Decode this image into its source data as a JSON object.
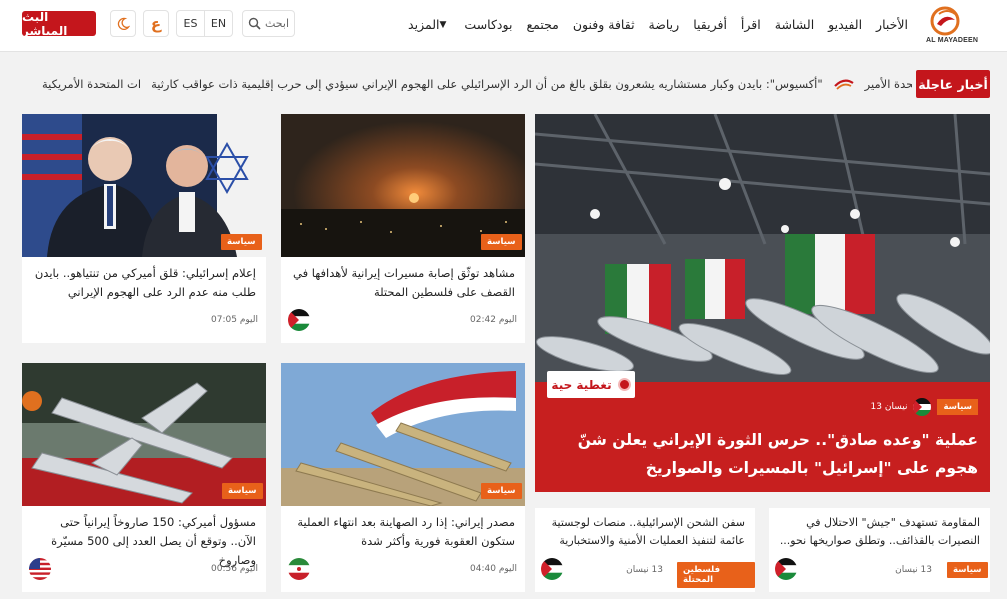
{
  "header": {
    "live_label": "البث المباشر",
    "arabic_label": "ع",
    "lang_en": "EN",
    "lang_es": "ES",
    "search_label": "ابحث",
    "logo_caption": "AL MAYADEEN",
    "nav": [
      "الأخبار",
      "الفيديو",
      "الشاشة",
      "اقرأ",
      "أفريقيا",
      "رياضة",
      "ثقافة وفنون",
      "مجتمع",
      "بودكاست",
      "المزيد"
    ]
  },
  "ticker": {
    "label": "أخبار عاجلة",
    "items": [
      "الولايات المتحدة الأمير",
      "\"أكسيوس\": بايدن وكبار مستشاريه يشعرون بقلق بالغ من أن الرد الإسرائيلي على الهجوم الإيراني سيؤدي إلى حرب إقليمية ذات عواقب كارثية",
      "ات المتحدة الأمريكية"
    ]
  },
  "feature": {
    "live_label": "تغطية حية",
    "tag": "سياسة",
    "date": "13 نيسان",
    "title": "عملية \"وعده صادق\".. حرس الثورة الإيراني يعلن شنّ هجوم على \"إسرائيل\" بالمسيرات والصواريخ"
  },
  "cards": [
    {
      "tag": "سياسة",
      "title": "إعلام إسرائيلي: قلق أميركي من تنتياهو.. بايدن طلب منه عدم الرد على الهجوم الإيراني",
      "time": "اليوم 07:05"
    },
    {
      "tag": "سياسة",
      "title": "مشاهد توثّق إصابة مسيرات إيرانية لأهدافها في القصف على فلسطين المحتلة",
      "time": "اليوم 02:42"
    },
    {
      "tag": "سياسة",
      "title": "مسؤول أميركي: 150 صاروخاً إيرانياً حتى الآن.. وتوقع أن يصل العدد إلى 500 مسيّرة وصاروخ",
      "time": "اليوم 00:56"
    },
    {
      "tag": "سياسة",
      "title": "مصدر إيراني: إذا رد الصهاينة بعد انتهاء العملية ستكون العقوبة فورية وأكثر شدة",
      "time": "اليوم 04:40"
    },
    {
      "tag": "فلسطين المحتلة",
      "title": "سفن الشحن الإسرائيلية.. منصات لوجستية عائمة لتنفيذ العمليات الأمنية والاستخبارية",
      "time": "13 نيسان"
    },
    {
      "tag": "سياسة",
      "title": "المقاومة تستهدف \"جيش\" الاحتلال في النصيرات بالقذائف.. وتطلق صواريخها نحو...",
      "time": "13 نيسان"
    }
  ]
}
